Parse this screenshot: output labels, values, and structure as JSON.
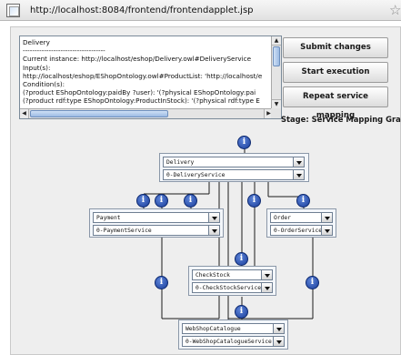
{
  "browser": {
    "url": "http://localhost:8084/frontend/frontendapplet.jsp"
  },
  "textarea": {
    "lines": [
      "Delivery",
      "-----------------------------------",
      "Current instance: http://localhost/eshop/Delivery.owl#DeliveryService",
      "Input(s):",
      "http://localhost/eshop/EShopOntology.owl#ProductList: 'http://localhost/e",
      "Condition(s):",
      "(?product EShopOntology:paidBy ?user): '(?physical EShopOntology:pai",
      "(?product rdf:type EShopOntology:ProductInStock): '(?physical rdf:type E"
    ]
  },
  "buttons": {
    "submit": "Submit changes",
    "start": "Start execution",
    "repeat": "Repeat service mapping"
  },
  "stage": "Stage: Service Mapping Graph",
  "graph": {
    "info_glyph": "i",
    "nodes": {
      "delivery": {
        "name": "Delivery",
        "service": "0-DeliveryService"
      },
      "payment": {
        "name": "Payment",
        "service": "0-PaymentService"
      },
      "order": {
        "name": "Order",
        "service": "0-OrderService"
      },
      "checkstock": {
        "name": "CheckStock",
        "service": "0-CheckStockService"
      },
      "webshop": {
        "name": "WebShopCatalogue",
        "service": "0-WebShopCatalogueService"
      }
    }
  },
  "colors": {
    "edge": "#1a1a1a",
    "info_icon": "#1f4aa8"
  }
}
